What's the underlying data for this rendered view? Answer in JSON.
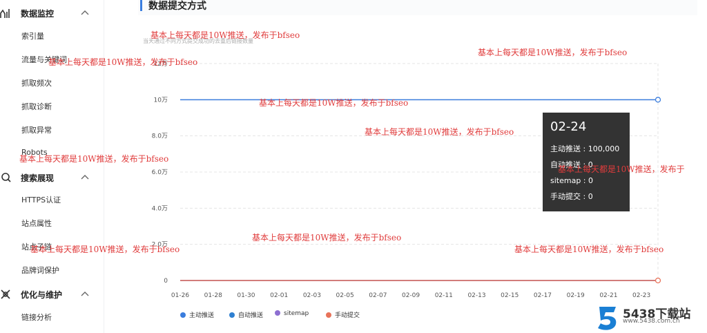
{
  "sidebar": {
    "sections": [
      {
        "title": "数据监控",
        "icon": "bar-chart-icon",
        "items": [
          "索引量",
          "流量与关键词",
          "抓取频次",
          "抓取诊断",
          "抓取异常",
          "Robots"
        ]
      },
      {
        "title": "搜索展现",
        "icon": "search-icon",
        "items": [
          "HTTPS认证",
          "站点属性",
          "站点子链",
          "品牌词保护"
        ]
      },
      {
        "title": "优化与维护",
        "icon": "tools-icon",
        "items": [
          "链接分析"
        ]
      }
    ]
  },
  "header": {
    "title": "数据提交方式",
    "subtitle": "当天通过不同方式提交成功的去重后链接数量"
  },
  "chart_data": {
    "type": "line",
    "categories": [
      "01-26",
      "01-28",
      "01-30",
      "02-01",
      "02-03",
      "02-05",
      "02-07",
      "02-09",
      "02-11",
      "02-13",
      "02-15",
      "02-17",
      "02-19",
      "02-21",
      "02-23"
    ],
    "x_range": [
      "01-26",
      "02-24"
    ],
    "y_ticks": [
      "0",
      "2.0万",
      "4.0万",
      "6.0万",
      "8.0万",
      "10万",
      "12万"
    ],
    "ylim": [
      0,
      120000
    ],
    "grid": "horizontal dashed",
    "legend_position": "bottom-left",
    "series": [
      {
        "name": "主动推送",
        "color": "#3b7ddd",
        "start": 100000,
        "end": 100000
      },
      {
        "name": "自动推送",
        "color": "#2f80d1",
        "start": 0,
        "end": 0
      },
      {
        "name": "sitemap",
        "color": "#8d6fd1",
        "start": 0,
        "end": 0
      },
      {
        "name": "手动提交",
        "color": "#e8735a",
        "start": 0,
        "end": 0
      }
    ],
    "tooltip": {
      "date": "02-24",
      "rows": [
        "主动推送 : 100,000",
        "自动推送 : 0",
        "sitemap : 0",
        "手动提交 : 0"
      ]
    }
  },
  "watermark_text": "基本上每天都是10W推送，发布于bfseo",
  "watermark_text_truncated": "基本上每天都是10W推送，发布于",
  "logo": {
    "brand": "5438下载站",
    "url": "www.5438.com.cn"
  },
  "colors": {
    "accent": "#3a7ee0",
    "watermark": "#e03c3c"
  }
}
